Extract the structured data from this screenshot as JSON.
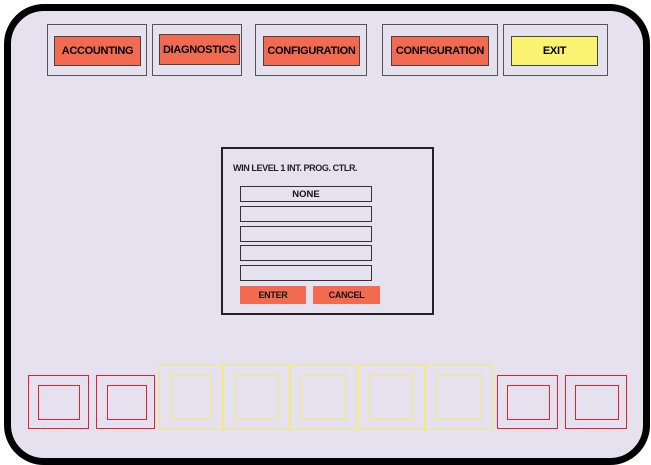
{
  "toolbar": {
    "buttons": [
      {
        "label": "ACCOUNTING",
        "color": "#f26a4f"
      },
      {
        "label": "DIAGNOSTICS",
        "color": "#f26a4f"
      },
      {
        "label": "CONFIGURATION",
        "color": "#f26a4f"
      },
      {
        "label": "CONFIGURATION",
        "color": "#f26a4f"
      },
      {
        "label": "EXIT",
        "color": "#faf372"
      }
    ]
  },
  "dialog": {
    "title": "WIN LEVEL 1 INT. PROG. CTLR.",
    "fields": [
      {
        "value": "NONE"
      },
      {
        "value": ""
      },
      {
        "value": ""
      },
      {
        "value": ""
      },
      {
        "value": ""
      }
    ],
    "enter_label": "ENTER",
    "cancel_label": "CANCEL"
  },
  "bottom_keys": {
    "colors": [
      "red",
      "red",
      "yellow",
      "yellow",
      "yellow",
      "yellow",
      "yellow",
      "red",
      "red"
    ]
  }
}
